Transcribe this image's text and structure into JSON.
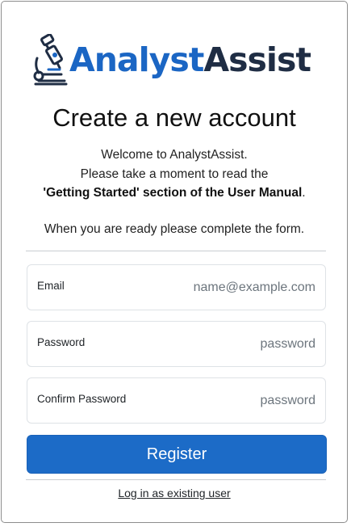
{
  "logo": {
    "icon": "microscope-icon",
    "word_part1": "Analyst",
    "word_part2": "Assist",
    "colors": {
      "primary": "#1b66c4",
      "dark": "#1f2d44"
    }
  },
  "heading": "Create a new account",
  "intro": {
    "line1": "Welcome to AnalystAssist.",
    "line2": "Please take a moment to read the",
    "line3_bold": "'Getting Started' section of the User Manual",
    "line3_end": "."
  },
  "ready_text": "When you are ready please complete the form.",
  "form": {
    "email": {
      "label": "Email",
      "placeholder": "name@example.com",
      "value": ""
    },
    "password": {
      "label": "Password",
      "placeholder": "password",
      "value": ""
    },
    "confirm_password": {
      "label": "Confirm Password",
      "placeholder": "password",
      "value": ""
    },
    "submit_label": "Register"
  },
  "login_link": "Log in as existing user",
  "colors": {
    "button": "#1c6bc7",
    "button_text": "#ffffff"
  }
}
